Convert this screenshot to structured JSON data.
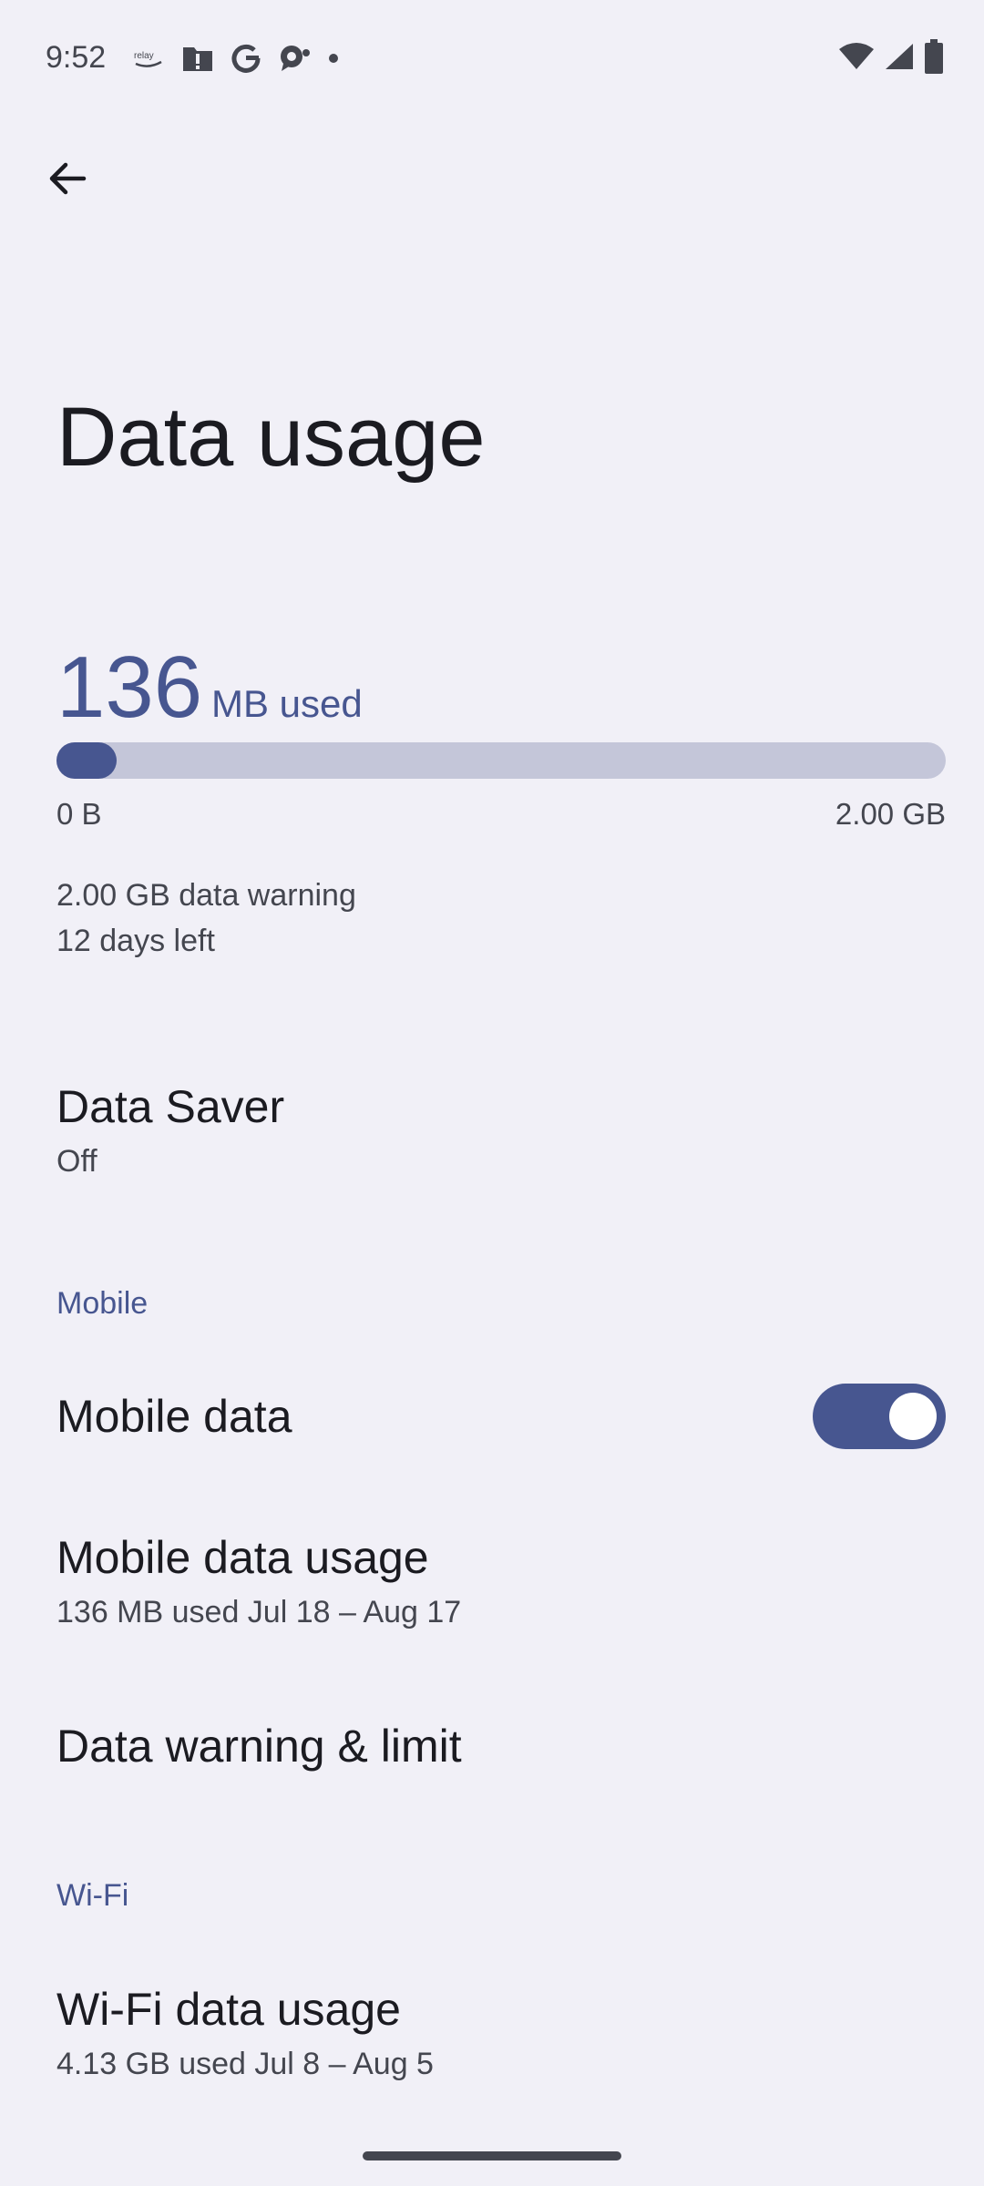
{
  "status_bar": {
    "time": "9:52",
    "left_icons": [
      "relay-icon",
      "alert-folder-icon",
      "google-icon",
      "chat-icon",
      "dot-icon"
    ],
    "right_icons": [
      "wifi-icon",
      "signal-icon",
      "battery-icon"
    ]
  },
  "header": {
    "back_icon": "arrow-back-icon",
    "title": "Data usage"
  },
  "usage": {
    "amount": "136",
    "unit_label": "MB used",
    "progress_fraction": 0.068,
    "range_min": "0 B",
    "range_max": "2.00 GB",
    "warning": "2.00 GB data warning",
    "days_left": "12 days left"
  },
  "data_saver": {
    "title": "Data Saver",
    "status": "Off"
  },
  "mobile_section": {
    "header": "Mobile",
    "mobile_data_label": "Mobile data",
    "mobile_data_on": true,
    "usage_title": "Mobile data usage",
    "usage_sub": "136 MB used Jul 18 – Aug 17",
    "warning_limit_label": "Data warning & limit"
  },
  "wifi_section": {
    "header": "Wi-Fi",
    "usage_title": "Wi-Fi data usage",
    "usage_sub": "4.13 GB used Jul 8 – Aug 5"
  },
  "colors": {
    "background": "#f1f0f7",
    "accent": "#475690",
    "track": "#c4c6d9",
    "text_primary": "#1b1b21",
    "text_secondary": "#44464f"
  }
}
